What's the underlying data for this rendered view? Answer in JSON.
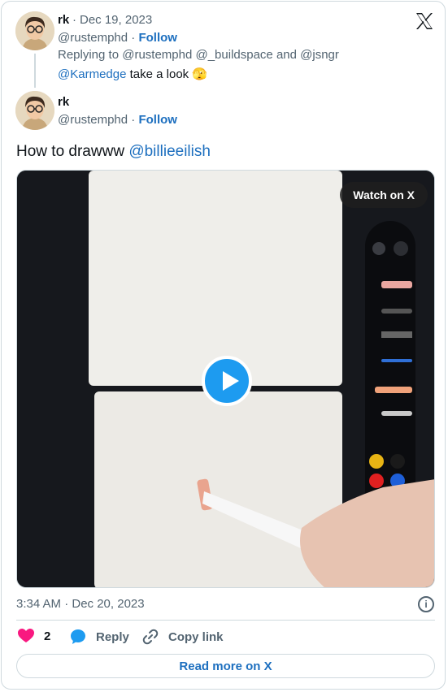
{
  "reply": {
    "name": "rk",
    "date": "Dec 19, 2023",
    "handle": "@rustemphd",
    "follow": "Follow",
    "replying_prefix": "Replying to",
    "replying_users": "@rustemphd @_buildspace and @jsngr",
    "mention": "@Karmedge",
    "text": "take a look 🫣"
  },
  "tweet": {
    "name": "rk",
    "handle": "@rustemphd",
    "follow": "Follow",
    "text": "How to drawww",
    "mention": "@billieeilish",
    "watch_label": "Watch on X",
    "timestamp": "3:34 AM · Dec 20, 2023"
  },
  "actions": {
    "like_count": "2",
    "reply_label": "Reply",
    "copy_label": "Copy link",
    "read_more": "Read more on X"
  },
  "colors": {
    "link": "#1d6fbf",
    "like": "#f91880",
    "play": "#1d9bf0"
  }
}
